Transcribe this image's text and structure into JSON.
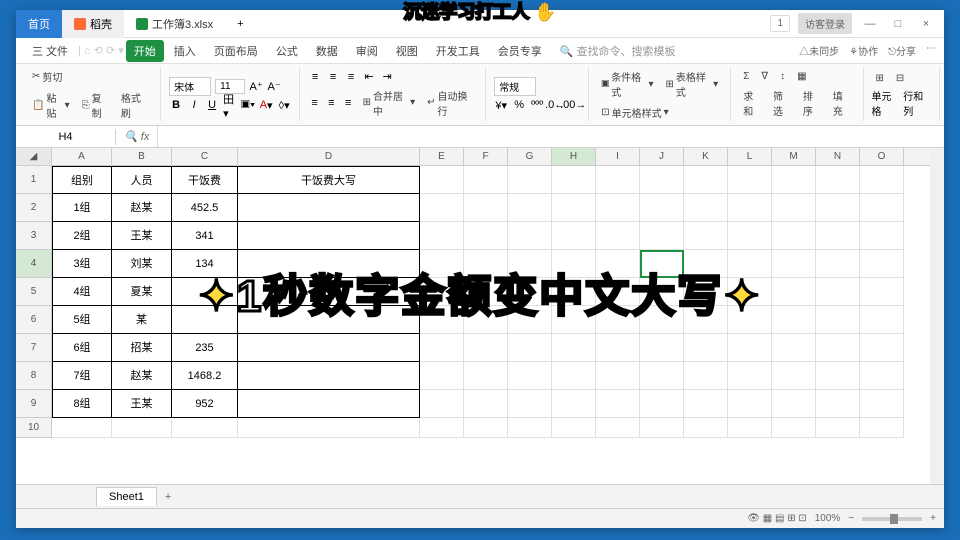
{
  "overlay": {
    "top_text": "沉迷学习打工人",
    "main_text": "1秒数字金额变中文大写"
  },
  "titlebar": {
    "home": "首页",
    "doc_name": "稻壳",
    "file_name": "工作簿3.xlsx",
    "login": "访客登录"
  },
  "menubar": {
    "file": "三 文件",
    "items": [
      "开始",
      "插入",
      "页面布局",
      "公式",
      "数据",
      "审阅",
      "视图",
      "开发工具",
      "会员专享"
    ],
    "search": "查找命令、搜索模板",
    "right": [
      "未同步",
      "协作",
      "分享"
    ]
  },
  "ribbon": {
    "cut": "剪切",
    "paste": "粘贴",
    "copy": "复制",
    "format_painter": "格式刷",
    "font": "宋体",
    "size": "11",
    "merge": "合并居中",
    "wrap": "自动换行",
    "general": "常规",
    "cond": "条件格式",
    "cellstyle": "表格样式",
    "cellfmt": "单元格样式",
    "sum": "求和",
    "filter": "筛选",
    "sort": "排序",
    "fill": "填充",
    "cell": "单元格",
    "rowcol": "行和列"
  },
  "formula": {
    "cell": "H4",
    "fx": "fx"
  },
  "columns": [
    "A",
    "B",
    "C",
    "D",
    "E",
    "F",
    "G",
    "H",
    "I",
    "J",
    "K",
    "L",
    "M",
    "N",
    "O"
  ],
  "headers": {
    "a": "组别",
    "b": "人员",
    "c": "干饭费",
    "d": "干饭费大写"
  },
  "rows": [
    {
      "n": "1",
      "a": "组别",
      "b": "人员",
      "c": "干饭费",
      "d": "干饭费大写",
      "hdr": true
    },
    {
      "n": "2",
      "a": "1组",
      "b": "赵某",
      "c": "452.5",
      "d": ""
    },
    {
      "n": "3",
      "a": "2组",
      "b": "王某",
      "c": "341",
      "d": ""
    },
    {
      "n": "4",
      "a": "3组",
      "b": "刘某",
      "c": "134",
      "d": ""
    },
    {
      "n": "5",
      "a": "4组",
      "b": "夏某",
      "c": "",
      "d": ""
    },
    {
      "n": "6",
      "a": "5组",
      "b": "某",
      "c": "",
      "d": ""
    },
    {
      "n": "7",
      "a": "6组",
      "b": "招某",
      "c": "235",
      "d": ""
    },
    {
      "n": "8",
      "a": "7组",
      "b": "赵某",
      "c": "1468.2",
      "d": ""
    },
    {
      "n": "9",
      "a": "8组",
      "b": "王某",
      "c": "952",
      "d": ""
    },
    {
      "n": "10",
      "a": "",
      "b": "",
      "c": "",
      "d": ""
    }
  ],
  "sheet": {
    "name": "Sheet1"
  },
  "status": {
    "zoom": "100%"
  }
}
